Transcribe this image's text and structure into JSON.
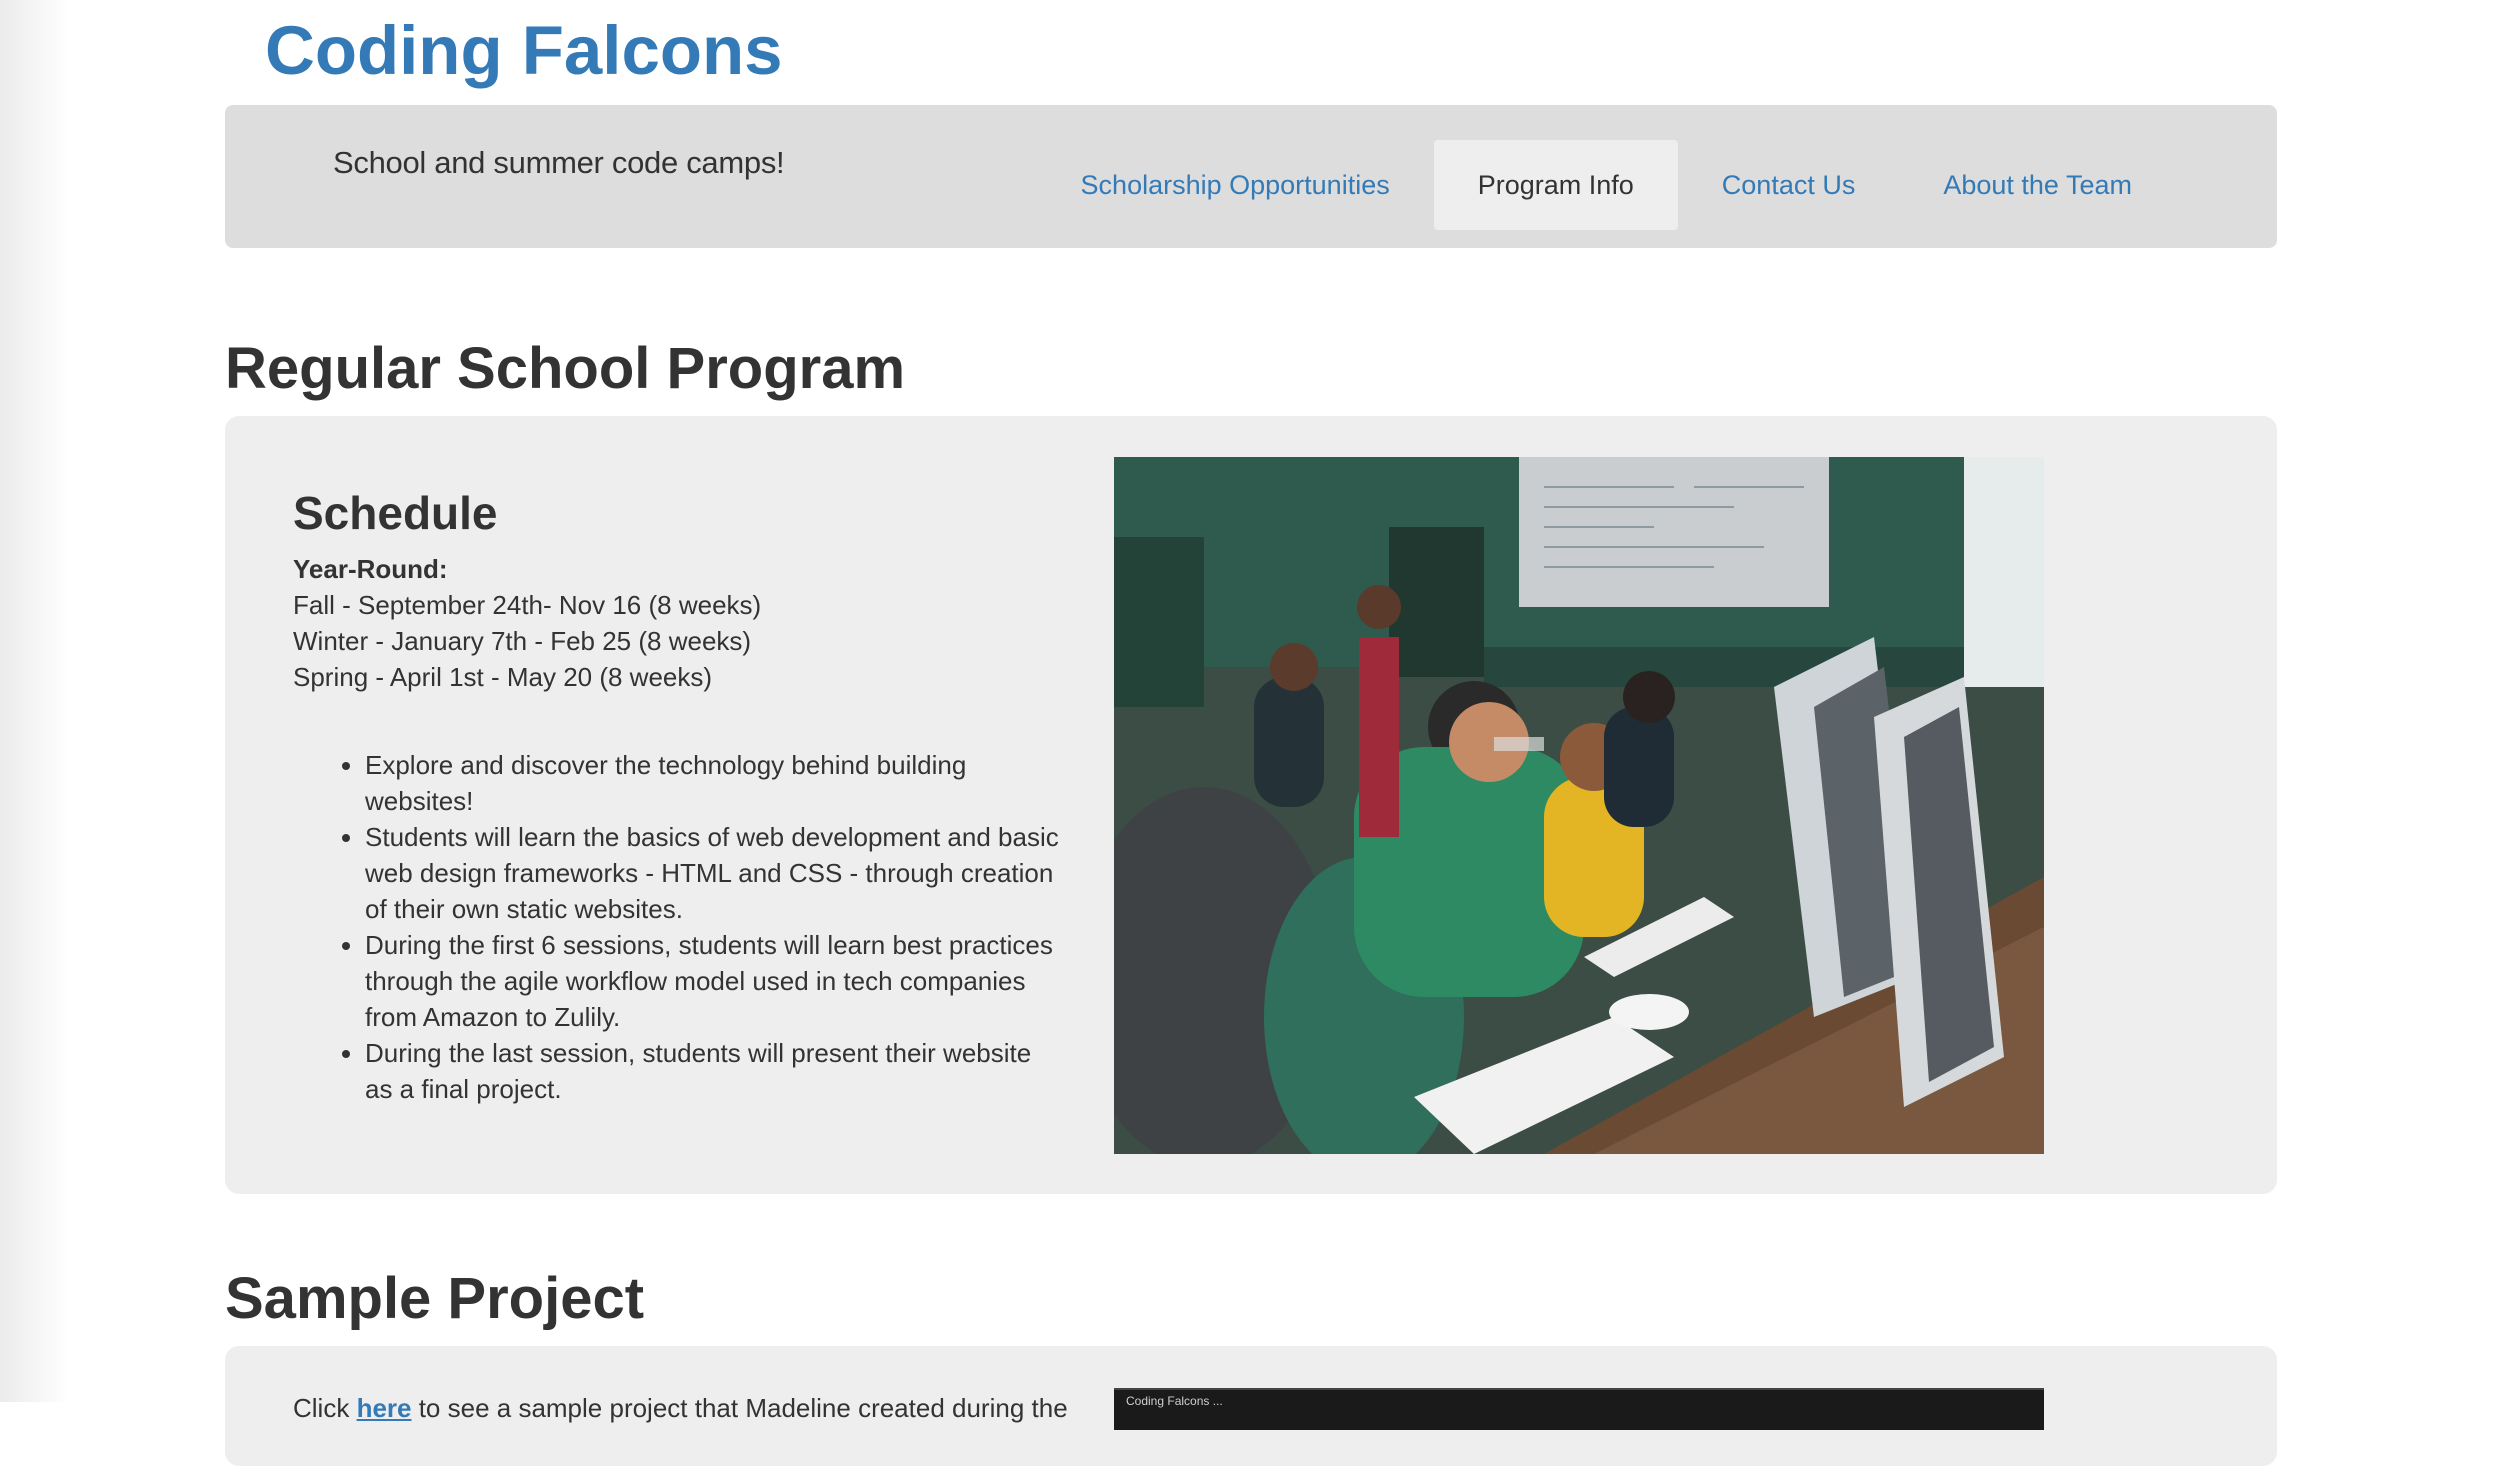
{
  "brand": {
    "title": "Coding Falcons"
  },
  "navbar": {
    "tagline": "School and summer code camps!",
    "links": [
      {
        "label": "Scholarship Opportunities",
        "active": false
      },
      {
        "label": "Program Info",
        "active": true
      },
      {
        "label": "Contact Us",
        "active": false
      },
      {
        "label": "About the Team",
        "active": false
      }
    ]
  },
  "regular_program": {
    "title": "Regular School Program",
    "schedule_heading": "Schedule",
    "year_round_label": "Year-Round:",
    "sessions": [
      "Fall - September 24th- Nov 16 (8 weeks)",
      "Winter - January 7th - Feb 25 (8 weeks)",
      "Spring - April 1st - May 20 (8 weeks)"
    ],
    "features": [
      "Explore and discover the technology behind building websites!",
      "Students will learn the basics of web development and basic web design frameworks - HTML and CSS - through creation of their own static websites.",
      "During the first 6 sessions, students will learn best practices through the agile workflow model used in tech companies from Amazon to Zulily.",
      "During the last session, students will present their website as a final project."
    ]
  },
  "sample_project": {
    "title": "Sample Project",
    "text_before_link": "Click ",
    "link_label": "here",
    "text_after_link": " to see a sample project that Madeline created during the",
    "video_title": "Coding Falcons ... "
  },
  "colors": {
    "brand": "#337ab7",
    "navbar_bg": "#dddddd",
    "panel_bg": "#eeeeee",
    "text": "#333333"
  }
}
